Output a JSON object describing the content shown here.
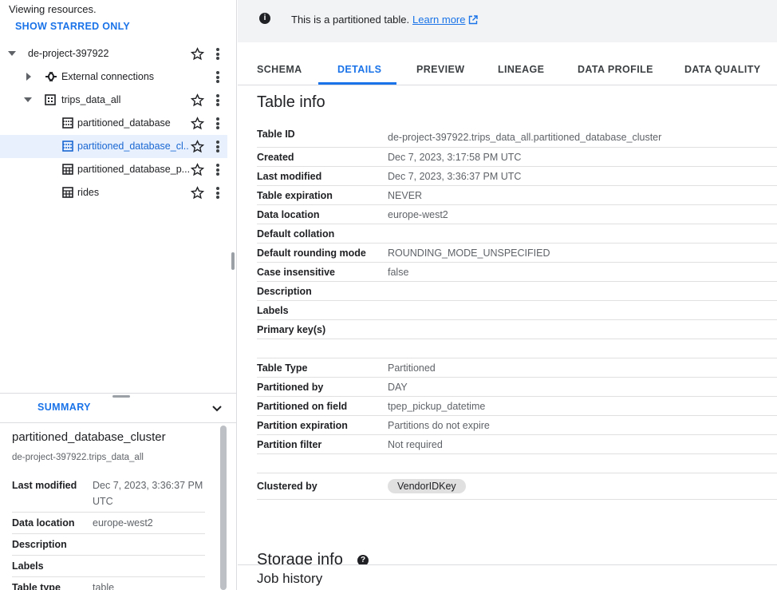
{
  "explorer": {
    "viewing_text": "Viewing resources.",
    "show_starred": "SHOW STARRED ONLY",
    "project": "de-project-397922",
    "external_connections": "External connections",
    "dataset": "trips_data_all",
    "tables": [
      "partitioned_database",
      "partitioned_database_cl...",
      "partitioned_database_p...",
      "rides"
    ]
  },
  "summary": {
    "tab_label": "SUMMARY",
    "title": "partitioned_database_cluster",
    "subtitle": "de-project-397922.trips_data_all",
    "rows": [
      {
        "key": "Last modified",
        "value": "Dec 7, 2023, 3:36:37 PM UTC"
      },
      {
        "key": "Data location",
        "value": "europe-west2"
      },
      {
        "key": "Description",
        "value": ""
      },
      {
        "key": "Labels",
        "value": ""
      },
      {
        "key": "Table type",
        "value": "table"
      }
    ]
  },
  "banner": {
    "text": "This is a partitioned table.",
    "link": "Learn more"
  },
  "tabs": [
    "SCHEMA",
    "DETAILS",
    "PREVIEW",
    "LINEAGE",
    "DATA PROFILE",
    "DATA QUALITY"
  ],
  "active_tab": "DETAILS",
  "table_info": {
    "heading": "Table info",
    "rows": [
      {
        "key": "Table ID",
        "value": "de-project-397922.trips_data_all.partitioned_database_cluster"
      },
      {
        "key": "Created",
        "value": "Dec 7, 2023, 3:17:58 PM UTC"
      },
      {
        "key": "Last modified",
        "value": "Dec 7, 2023, 3:36:37 PM UTC"
      },
      {
        "key": "Table expiration",
        "value": "NEVER"
      },
      {
        "key": "Data location",
        "value": "europe-west2"
      },
      {
        "key": "Default collation",
        "value": ""
      },
      {
        "key": "Default rounding mode",
        "value": "ROUNDING_MODE_UNSPECIFIED"
      },
      {
        "key": "Case insensitive",
        "value": "false"
      },
      {
        "key": "Description",
        "value": ""
      },
      {
        "key": "Labels",
        "value": ""
      },
      {
        "key": "Primary key(s)",
        "value": ""
      }
    ],
    "partition_rows": [
      {
        "key": "Table Type",
        "value": "Partitioned"
      },
      {
        "key": "Partitioned by",
        "value": "DAY"
      },
      {
        "key": "Partitioned on field",
        "value": "tpep_pickup_datetime"
      },
      {
        "key": "Partition expiration",
        "value": "Partitions do not expire"
      },
      {
        "key": "Partition filter",
        "value": "Not required"
      }
    ],
    "clustered_by_label": "Clustered by",
    "clustered_by_value": "VendorIDKey"
  },
  "storage_heading": "Storage info",
  "job_history": "Job history",
  "colors": {
    "accent": "#1a73e8",
    "selected_bg": "#e8f0fe",
    "banner_bg": "#f1f3f4"
  }
}
